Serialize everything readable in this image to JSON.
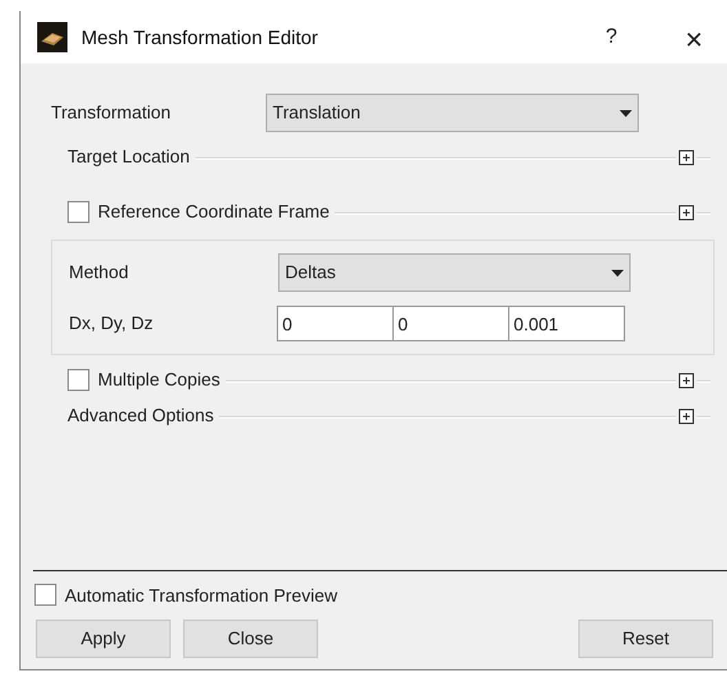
{
  "window": {
    "title": "Mesh Transformation Editor",
    "help": "?",
    "close": "×"
  },
  "transformation": {
    "label": "Transformation",
    "value": "Translation"
  },
  "groups_top": [
    {
      "kind": "plain",
      "label": "Target Location",
      "expanded": false
    },
    {
      "kind": "checkbox",
      "label": "Reference Coordinate Frame",
      "checked": false,
      "expanded": false
    }
  ],
  "method_panel": {
    "method": {
      "label": "Method",
      "value": "Deltas"
    },
    "deltas": {
      "label": "Dx, Dy, Dz",
      "values": [
        "0",
        "0",
        "0.001"
      ]
    }
  },
  "groups_bottom": [
    {
      "kind": "checkbox",
      "label": "Multiple Copies",
      "checked": false,
      "expanded": false
    },
    {
      "kind": "plain",
      "label": "Advanced Options",
      "expanded": false
    }
  ],
  "preview": {
    "label": "Automatic Transformation Preview",
    "checked": false
  },
  "buttons_left": [
    "Apply",
    "Close"
  ],
  "buttons_right": [
    "Reset"
  ]
}
